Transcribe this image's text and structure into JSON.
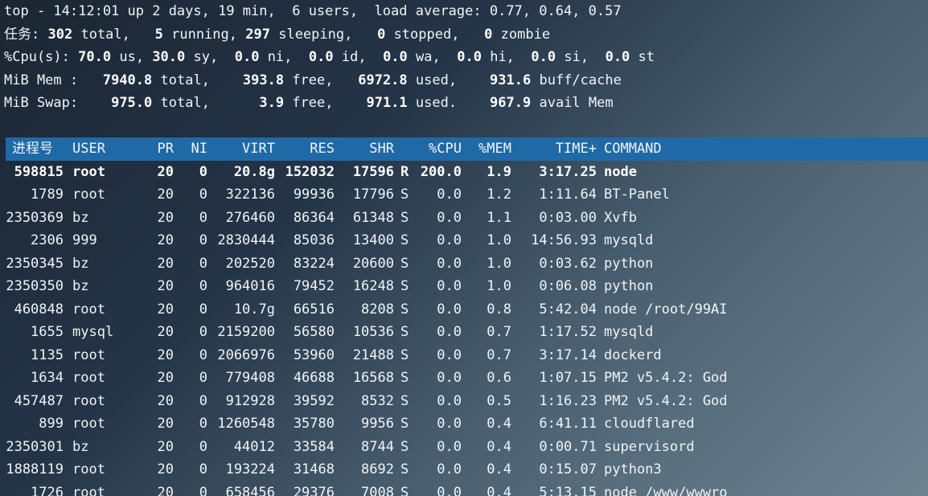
{
  "summary": {
    "uptime_line": "top - 14:12:01 up 2 days, 19 min,  6 users,  load average: 0.77, 0.64, 0.57",
    "tasks": {
      "label": "任务:",
      "total": "302",
      "total_label": "total,",
      "running": "5",
      "running_label": "running,",
      "sleeping": "297",
      "sleeping_label": "sleeping,",
      "stopped": "0",
      "stopped_label": "stopped,",
      "zombie": "0",
      "zombie_label": "zombie"
    },
    "cpu": {
      "label": "%Cpu(s):",
      "us": "70.0",
      "us_label": "us,",
      "sy": "30.0",
      "sy_label": "sy,",
      "ni": "0.0",
      "ni_label": "ni,",
      "id": "0.0",
      "id_label": "id,",
      "wa": "0.0",
      "wa_label": "wa,",
      "hi": "0.0",
      "hi_label": "hi,",
      "si": "0.0",
      "si_label": "si,",
      "st": "0.0",
      "st_label": "st"
    },
    "mem": {
      "label": "MiB Mem :",
      "total": "7940.8",
      "total_label": "total,",
      "free": "393.8",
      "free_label": "free,",
      "used": "6972.8",
      "used_label": "used,",
      "buff": "931.6",
      "buff_label": "buff/cache"
    },
    "swap": {
      "label": "MiB Swap:",
      "total": "975.0",
      "total_label": "total,",
      "free": "3.9",
      "free_label": "free,",
      "used": "971.1",
      "used_label": "used.",
      "avail": "967.9",
      "avail_label": "avail Mem"
    }
  },
  "columns": {
    "pid": "进程号",
    "user": "USER",
    "pr": "PR",
    "ni": "NI",
    "virt": "VIRT",
    "res": "RES",
    "shr": "SHR",
    "s": "",
    "cpu": "%CPU",
    "mem": "%MEM",
    "time": "TIME+",
    "cmd": "COMMAND"
  },
  "processes": [
    {
      "pid": "598815",
      "user": "root",
      "pr": "20",
      "ni": "0",
      "virt": "20.8g",
      "res": "152032",
      "shr": "17596",
      "s": "R",
      "cpu": "200.0",
      "mem": "1.9",
      "time": "3:17.25",
      "cmd": "node",
      "bold": true
    },
    {
      "pid": "1789",
      "user": "root",
      "pr": "20",
      "ni": "0",
      "virt": "322136",
      "res": "99936",
      "shr": "17796",
      "s": "S",
      "cpu": "0.0",
      "mem": "1.2",
      "time": "1:11.64",
      "cmd": "BT-Panel"
    },
    {
      "pid": "2350369",
      "user": "bz",
      "pr": "20",
      "ni": "0",
      "virt": "276460",
      "res": "86364",
      "shr": "61348",
      "s": "S",
      "cpu": "0.0",
      "mem": "1.1",
      "time": "0:03.00",
      "cmd": "Xvfb"
    },
    {
      "pid": "2306",
      "user": "999",
      "pr": "20",
      "ni": "0",
      "virt": "2830444",
      "res": "85036",
      "shr": "13400",
      "s": "S",
      "cpu": "0.0",
      "mem": "1.0",
      "time": "14:56.93",
      "cmd": "mysqld"
    },
    {
      "pid": "2350345",
      "user": "bz",
      "pr": "20",
      "ni": "0",
      "virt": "202520",
      "res": "83224",
      "shr": "20600",
      "s": "S",
      "cpu": "0.0",
      "mem": "1.0",
      "time": "0:03.62",
      "cmd": "python"
    },
    {
      "pid": "2350350",
      "user": "bz",
      "pr": "20",
      "ni": "0",
      "virt": "964016",
      "res": "79452",
      "shr": "16248",
      "s": "S",
      "cpu": "0.0",
      "mem": "1.0",
      "time": "0:06.08",
      "cmd": "python"
    },
    {
      "pid": "460848",
      "user": "root",
      "pr": "20",
      "ni": "0",
      "virt": "10.7g",
      "res": "66516",
      "shr": "8208",
      "s": "S",
      "cpu": "0.0",
      "mem": "0.8",
      "time": "5:42.04",
      "cmd": "node /root/99AI"
    },
    {
      "pid": "1655",
      "user": "mysql",
      "pr": "20",
      "ni": "0",
      "virt": "2159200",
      "res": "56580",
      "shr": "10536",
      "s": "S",
      "cpu": "0.0",
      "mem": "0.7",
      "time": "1:17.52",
      "cmd": "mysqld"
    },
    {
      "pid": "1135",
      "user": "root",
      "pr": "20",
      "ni": "0",
      "virt": "2066976",
      "res": "53960",
      "shr": "21488",
      "s": "S",
      "cpu": "0.0",
      "mem": "0.7",
      "time": "3:17.14",
      "cmd": "dockerd"
    },
    {
      "pid": "1634",
      "user": "root",
      "pr": "20",
      "ni": "0",
      "virt": "779408",
      "res": "46688",
      "shr": "16568",
      "s": "S",
      "cpu": "0.0",
      "mem": "0.6",
      "time": "1:07.15",
      "cmd": "PM2 v5.4.2: God"
    },
    {
      "pid": "457487",
      "user": "root",
      "pr": "20",
      "ni": "0",
      "virt": "912928",
      "res": "39592",
      "shr": "8532",
      "s": "S",
      "cpu": "0.0",
      "mem": "0.5",
      "time": "1:16.23",
      "cmd": "PM2 v5.4.2: God"
    },
    {
      "pid": "899",
      "user": "root",
      "pr": "20",
      "ni": "0",
      "virt": "1260548",
      "res": "35780",
      "shr": "9956",
      "s": "S",
      "cpu": "0.0",
      "mem": "0.4",
      "time": "6:41.11",
      "cmd": "cloudflared"
    },
    {
      "pid": "2350301",
      "user": "bz",
      "pr": "20",
      "ni": "0",
      "virt": "44012",
      "res": "33584",
      "shr": "8744",
      "s": "S",
      "cpu": "0.0",
      "mem": "0.4",
      "time": "0:00.71",
      "cmd": "supervisord"
    },
    {
      "pid": "1888119",
      "user": "root",
      "pr": "20",
      "ni": "0",
      "virt": "193224",
      "res": "31468",
      "shr": "8692",
      "s": "S",
      "cpu": "0.0",
      "mem": "0.4",
      "time": "0:15.07",
      "cmd": "python3"
    },
    {
      "pid": "1726",
      "user": "root",
      "pr": "20",
      "ni": "0",
      "virt": "658456",
      "res": "29376",
      "shr": "7008",
      "s": "S",
      "cpu": "0.0",
      "mem": "0.4",
      "time": "5:13.15",
      "cmd": "node /www/wwwro"
    }
  ]
}
